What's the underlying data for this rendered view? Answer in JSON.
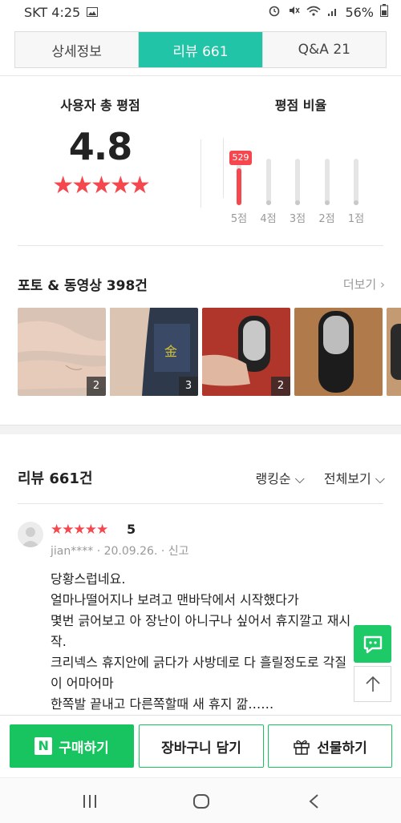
{
  "status": {
    "carrier_time": "SKT 4:25",
    "battery": "56%"
  },
  "tabs": [
    {
      "label": "상세정보"
    },
    {
      "label": "리뷰  661"
    },
    {
      "label": "Q&A  21"
    }
  ],
  "rating": {
    "title": "사용자 총 평점",
    "score": "4.8",
    "stars": "★★★★★",
    "ratio_title": "평점 비율",
    "top_badge": "529",
    "bars": [
      {
        "label": "5점",
        "fill": 0.8
      },
      {
        "label": "4점",
        "fill": 0
      },
      {
        "label": "3점",
        "fill": 0
      },
      {
        "label": "2점",
        "fill": 0
      },
      {
        "label": "1점",
        "fill": 0
      }
    ]
  },
  "photos": {
    "title": "포토 & 동영상 398건",
    "more": "더보기",
    "items": [
      {
        "count": "2"
      },
      {
        "count": "3"
      },
      {
        "count": "2"
      },
      {
        "count": ""
      },
      {
        "count": ""
      }
    ]
  },
  "reviews": {
    "title": "리뷰 661건",
    "sort": "랭킹순",
    "filter": "전체보기",
    "first": {
      "stars": "★★★★★",
      "score": "5",
      "user": "jian****",
      "date": "20.09.26.",
      "report": "신고",
      "lines": [
        "당황스럽네요.",
        "얼마나떨어지나 보려고 맨바닥에서 시작했다가",
        "몇번 긁어보고 아 장난이 아니구나 싶어서 휴지깔고 재시",
        "작.",
        "크리넥스 휴지안에 긁다가 사방데로 다 흘릴정도로 각질",
        "이 어마어마",
        "한쪽발 끝내고 다른쪽할때 새 휴지 깖……"
      ]
    }
  },
  "bottom": {
    "buy": "구매하기",
    "cart": "장바구니 담기",
    "gift": "선물하기"
  }
}
